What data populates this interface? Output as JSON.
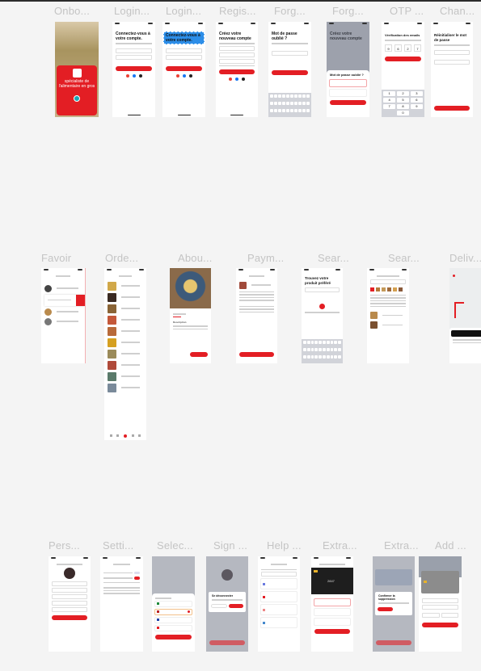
{
  "canvas": {
    "background": "#f4f4f4",
    "accent": "#e31e24"
  },
  "frames": {
    "onboarding": {
      "title": "Onbo...",
      "tagline": "spécialiste de l'alimentaire en gros"
    },
    "login1": {
      "title": "Login...",
      "heading": "Connectez-vous à votre compte."
    },
    "login2": {
      "title": "Login...",
      "heading": "Connectez-vous à votre compte."
    },
    "register": {
      "title": "Regis...",
      "heading": "Créez votre nouveau compte"
    },
    "forgot1": {
      "title": "Forg...",
      "heading": "Mot de passe oublié ?"
    },
    "forgot2": {
      "title": "Forg...",
      "bg_heading": "Créez votre nouveau compte",
      "heading": "Mot de passe oublié ?"
    },
    "otp": {
      "title": "OTP ...",
      "heading": "Vérification des emails",
      "digits": [
        "9",
        "6",
        "2",
        "7"
      ],
      "keys": [
        "1",
        "2",
        "3",
        "4",
        "5",
        "6",
        "7",
        "8",
        "9",
        "0"
      ]
    },
    "change": {
      "title": "Chan...",
      "heading": "Réinitialiser le mot de passe"
    },
    "favorites": {
      "title": "Favoir"
    },
    "orders": {
      "title": "Orde..."
    },
    "about": {
      "title": "Abou...",
      "section": "Description"
    },
    "payment": {
      "title": "Paym..."
    },
    "search1": {
      "title": "Sear...",
      "heading": "Trouvez votre produit préféré"
    },
    "search2": {
      "title": "Sear..."
    },
    "delivery": {
      "title": "Deliv..."
    },
    "personal": {
      "title": "Pers..."
    },
    "settings": {
      "title": "Setti..."
    },
    "select": {
      "title": "Selec..."
    },
    "signout": {
      "title": "Sign ...",
      "dialog": "Se déconnecter"
    },
    "help": {
      "title": "Help ..."
    },
    "extra1": {
      "title": "Extra...",
      "card_number": "2847"
    },
    "extra2": {
      "title": "Extra...",
      "dialog": "Confirmer la suppression"
    },
    "add": {
      "title": "Add ..."
    }
  }
}
